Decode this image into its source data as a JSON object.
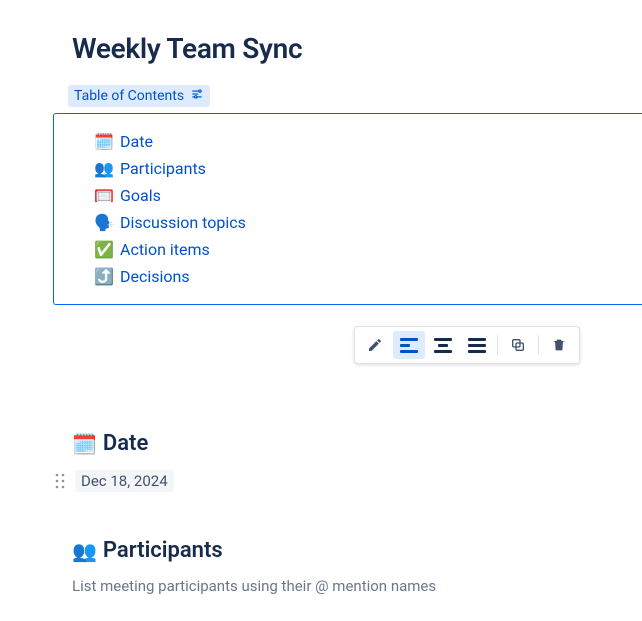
{
  "title": "Weekly Team Sync",
  "toc": {
    "label": "Table of Contents",
    "items": [
      {
        "emoji": "🗓️",
        "label": "Date"
      },
      {
        "emoji": "👥",
        "label": "Participants"
      },
      {
        "emoji": "🥅",
        "label": "Goals"
      },
      {
        "emoji": "🗣️",
        "label": "Discussion topics"
      },
      {
        "emoji": "✅",
        "label": "Action items"
      },
      {
        "emoji": "⤴️",
        "label": "Decisions"
      }
    ]
  },
  "sections": {
    "date": {
      "emoji": "🗓️",
      "heading": "Date",
      "value": "Dec 18, 2024"
    },
    "participants": {
      "emoji": "👥",
      "heading": "Participants",
      "placeholder": "List meeting participants using their @ mention names"
    }
  }
}
